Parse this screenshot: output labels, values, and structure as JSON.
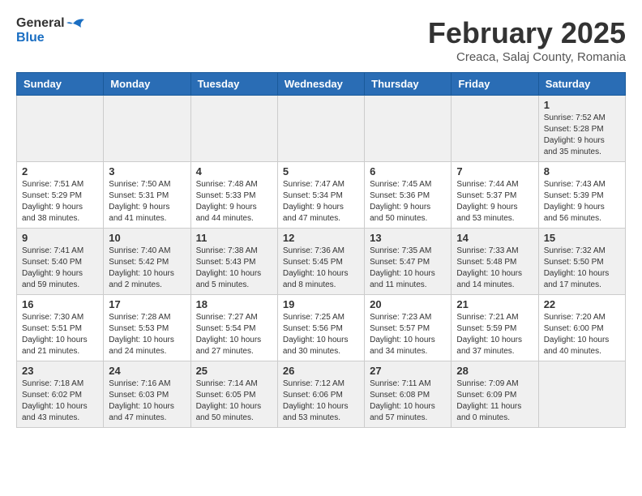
{
  "header": {
    "logo_general": "General",
    "logo_blue": "Blue",
    "title": "February 2025",
    "subtitle": "Creaca, Salaj County, Romania"
  },
  "days_of_week": [
    "Sunday",
    "Monday",
    "Tuesday",
    "Wednesday",
    "Thursday",
    "Friday",
    "Saturday"
  ],
  "weeks": [
    [
      {
        "day": "",
        "info": ""
      },
      {
        "day": "",
        "info": ""
      },
      {
        "day": "",
        "info": ""
      },
      {
        "day": "",
        "info": ""
      },
      {
        "day": "",
        "info": ""
      },
      {
        "day": "",
        "info": ""
      },
      {
        "day": "1",
        "info": "Sunrise: 7:52 AM\nSunset: 5:28 PM\nDaylight: 9 hours and 35 minutes."
      }
    ],
    [
      {
        "day": "2",
        "info": "Sunrise: 7:51 AM\nSunset: 5:29 PM\nDaylight: 9 hours and 38 minutes."
      },
      {
        "day": "3",
        "info": "Sunrise: 7:50 AM\nSunset: 5:31 PM\nDaylight: 9 hours and 41 minutes."
      },
      {
        "day": "4",
        "info": "Sunrise: 7:48 AM\nSunset: 5:33 PM\nDaylight: 9 hours and 44 minutes."
      },
      {
        "day": "5",
        "info": "Sunrise: 7:47 AM\nSunset: 5:34 PM\nDaylight: 9 hours and 47 minutes."
      },
      {
        "day": "6",
        "info": "Sunrise: 7:45 AM\nSunset: 5:36 PM\nDaylight: 9 hours and 50 minutes."
      },
      {
        "day": "7",
        "info": "Sunrise: 7:44 AM\nSunset: 5:37 PM\nDaylight: 9 hours and 53 minutes."
      },
      {
        "day": "8",
        "info": "Sunrise: 7:43 AM\nSunset: 5:39 PM\nDaylight: 9 hours and 56 minutes."
      }
    ],
    [
      {
        "day": "9",
        "info": "Sunrise: 7:41 AM\nSunset: 5:40 PM\nDaylight: 9 hours and 59 minutes."
      },
      {
        "day": "10",
        "info": "Sunrise: 7:40 AM\nSunset: 5:42 PM\nDaylight: 10 hours and 2 minutes."
      },
      {
        "day": "11",
        "info": "Sunrise: 7:38 AM\nSunset: 5:43 PM\nDaylight: 10 hours and 5 minutes."
      },
      {
        "day": "12",
        "info": "Sunrise: 7:36 AM\nSunset: 5:45 PM\nDaylight: 10 hours and 8 minutes."
      },
      {
        "day": "13",
        "info": "Sunrise: 7:35 AM\nSunset: 5:47 PM\nDaylight: 10 hours and 11 minutes."
      },
      {
        "day": "14",
        "info": "Sunrise: 7:33 AM\nSunset: 5:48 PM\nDaylight: 10 hours and 14 minutes."
      },
      {
        "day": "15",
        "info": "Sunrise: 7:32 AM\nSunset: 5:50 PM\nDaylight: 10 hours and 17 minutes."
      }
    ],
    [
      {
        "day": "16",
        "info": "Sunrise: 7:30 AM\nSunset: 5:51 PM\nDaylight: 10 hours and 21 minutes."
      },
      {
        "day": "17",
        "info": "Sunrise: 7:28 AM\nSunset: 5:53 PM\nDaylight: 10 hours and 24 minutes."
      },
      {
        "day": "18",
        "info": "Sunrise: 7:27 AM\nSunset: 5:54 PM\nDaylight: 10 hours and 27 minutes."
      },
      {
        "day": "19",
        "info": "Sunrise: 7:25 AM\nSunset: 5:56 PM\nDaylight: 10 hours and 30 minutes."
      },
      {
        "day": "20",
        "info": "Sunrise: 7:23 AM\nSunset: 5:57 PM\nDaylight: 10 hours and 34 minutes."
      },
      {
        "day": "21",
        "info": "Sunrise: 7:21 AM\nSunset: 5:59 PM\nDaylight: 10 hours and 37 minutes."
      },
      {
        "day": "22",
        "info": "Sunrise: 7:20 AM\nSunset: 6:00 PM\nDaylight: 10 hours and 40 minutes."
      }
    ],
    [
      {
        "day": "23",
        "info": "Sunrise: 7:18 AM\nSunset: 6:02 PM\nDaylight: 10 hours and 43 minutes."
      },
      {
        "day": "24",
        "info": "Sunrise: 7:16 AM\nSunset: 6:03 PM\nDaylight: 10 hours and 47 minutes."
      },
      {
        "day": "25",
        "info": "Sunrise: 7:14 AM\nSunset: 6:05 PM\nDaylight: 10 hours and 50 minutes."
      },
      {
        "day": "26",
        "info": "Sunrise: 7:12 AM\nSunset: 6:06 PM\nDaylight: 10 hours and 53 minutes."
      },
      {
        "day": "27",
        "info": "Sunrise: 7:11 AM\nSunset: 6:08 PM\nDaylight: 10 hours and 57 minutes."
      },
      {
        "day": "28",
        "info": "Sunrise: 7:09 AM\nSunset: 6:09 PM\nDaylight: 11 hours and 0 minutes."
      },
      {
        "day": "",
        "info": ""
      }
    ]
  ]
}
